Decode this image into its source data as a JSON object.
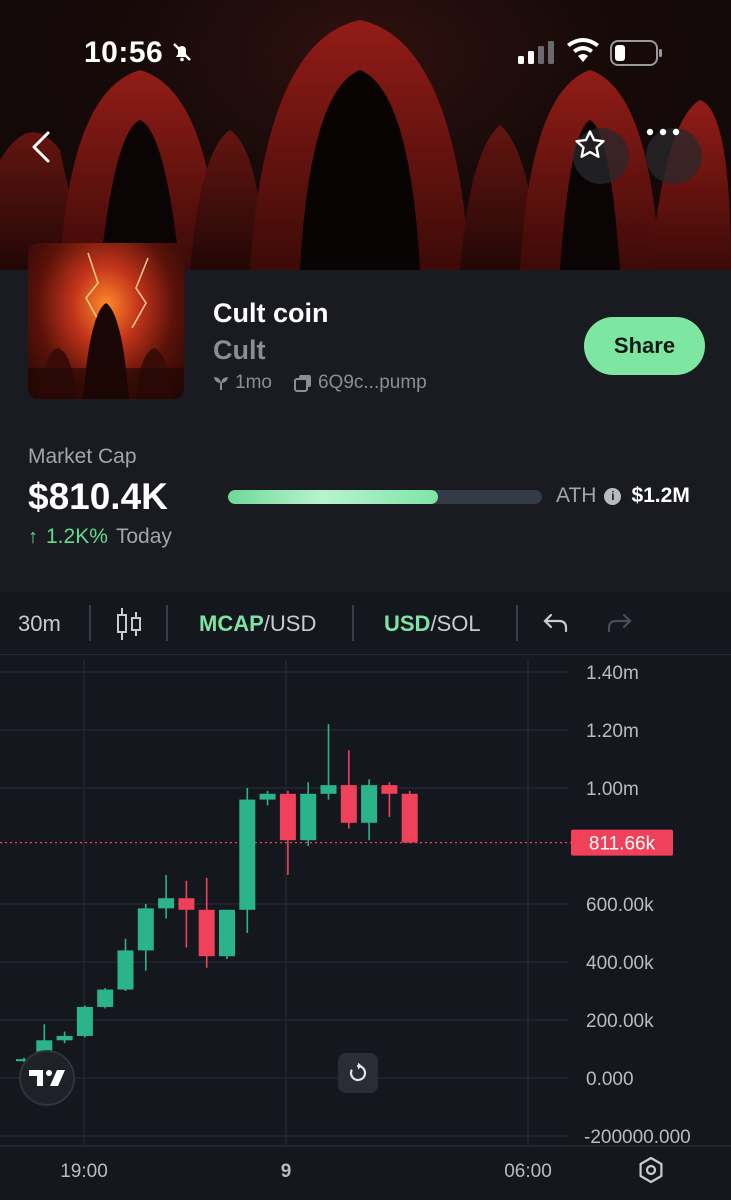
{
  "status_bar": {
    "time": "10:56"
  },
  "token": {
    "name": "Cult coin",
    "ticker": "Cult",
    "age": "1mo",
    "address": "6Q9c...pump"
  },
  "actions": {
    "share_label": "Share"
  },
  "market": {
    "label": "Market Cap",
    "value": "$810.4K",
    "change_pct": "1.2K%",
    "change_period": "Today",
    "ath_label": "ATH",
    "ath_value": "$1.2M",
    "progress_fraction": 0.67
  },
  "toolbar": {
    "interval": "30m",
    "mcap_label": "MCAP",
    "mcap_unit": "/USD",
    "usd_label": "USD",
    "usd_unit": "/SOL"
  },
  "chart_data": {
    "type": "candlestick",
    "x_labels": [
      "19:00",
      "9",
      "06:00"
    ],
    "y_ticks": [
      "1.40m",
      "1.20m",
      "1.00m",
      "600.00k",
      "400.00k",
      "200.00k",
      "0.000",
      "-200000.000"
    ],
    "current_label": "811.66k",
    "current_value": 811660,
    "candles": [
      {
        "o": 60000,
        "h": 70000,
        "l": 55000,
        "c": 65000
      },
      {
        "o": 65000,
        "h": 185000,
        "l": 60000,
        "c": 130000
      },
      {
        "o": 130000,
        "h": 160000,
        "l": 120000,
        "c": 145000
      },
      {
        "o": 145000,
        "h": 250000,
        "l": 140000,
        "c": 245000
      },
      {
        "o": 245000,
        "h": 310000,
        "l": 240000,
        "c": 305000
      },
      {
        "o": 305000,
        "h": 480000,
        "l": 300000,
        "c": 440000
      },
      {
        "o": 440000,
        "h": 600000,
        "l": 370000,
        "c": 585000
      },
      {
        "o": 585000,
        "h": 700000,
        "l": 550000,
        "c": 620000
      },
      {
        "o": 620000,
        "h": 680000,
        "l": 450000,
        "c": 580000
      },
      {
        "o": 580000,
        "h": 690000,
        "l": 380000,
        "c": 420000
      },
      {
        "o": 420000,
        "h": 580000,
        "l": 410000,
        "c": 580000
      },
      {
        "o": 580000,
        "h": 1000000,
        "l": 500000,
        "c": 960000
      },
      {
        "o": 960000,
        "h": 990000,
        "l": 940000,
        "c": 980000
      },
      {
        "o": 980000,
        "h": 990000,
        "l": 700000,
        "c": 820000
      },
      {
        "o": 820000,
        "h": 1020000,
        "l": 800000,
        "c": 980000
      },
      {
        "o": 980000,
        "h": 1220000,
        "l": 960000,
        "c": 1010000
      },
      {
        "o": 1010000,
        "h": 1130000,
        "l": 860000,
        "c": 880000
      },
      {
        "o": 880000,
        "h": 1030000,
        "l": 820000,
        "c": 1010000
      },
      {
        "o": 1010000,
        "h": 1020000,
        "l": 900000,
        "c": 980000
      },
      {
        "o": 980000,
        "h": 990000,
        "l": 810000,
        "c": 812000
      }
    ],
    "colors": {
      "up": "#2bb38a",
      "down": "#f0415a",
      "label_bg": "#f0415a"
    }
  }
}
